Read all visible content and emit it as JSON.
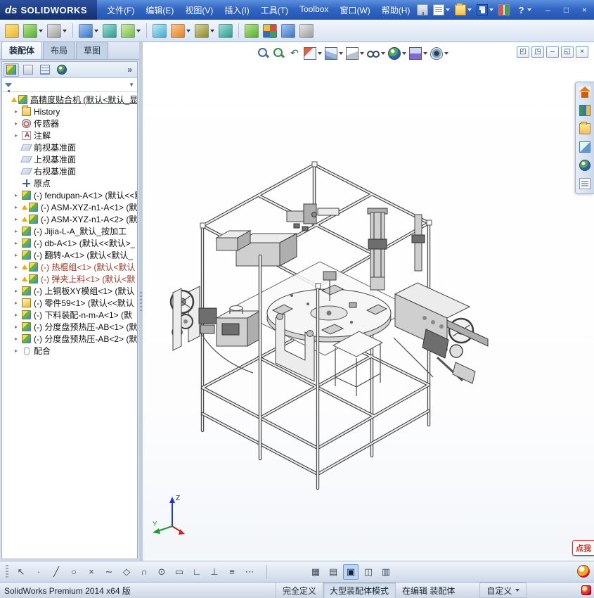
{
  "titlebar": {
    "logo_mark": "ds",
    "logo_brand": "SOLIDWORKS",
    "menus": [
      {
        "label": "文件(F)",
        "name": "menu-file"
      },
      {
        "label": "编辑(E)",
        "name": "menu-edit"
      },
      {
        "label": "视图(V)",
        "name": "menu-view"
      },
      {
        "label": "插入(I)",
        "name": "menu-insert"
      },
      {
        "label": "工具(T)",
        "name": "menu-tools"
      },
      {
        "label": "Toolbox",
        "name": "menu-toolbox"
      },
      {
        "label": "窗口(W)",
        "name": "menu-window"
      },
      {
        "label": "帮助(H)",
        "name": "menu-help"
      }
    ],
    "quick_icons": [
      {
        "name": "pin-icon",
        "cls": "i-pin"
      },
      {
        "name": "new-document-icon",
        "cls": "i-new",
        "dd": true
      },
      {
        "name": "open-icon",
        "cls": "i-folder",
        "dd": true
      },
      {
        "name": "save-icon",
        "cls": "i-save",
        "dd": true
      },
      {
        "name": "selection-filter-icon",
        "cls": "i-options"
      },
      {
        "name": "help-icon",
        "cls": "i-help",
        "dd": true
      }
    ],
    "window_buttons": [
      {
        "name": "minimize-window-button",
        "glyph": "–"
      },
      {
        "name": "restore-window-button",
        "glyph": "□"
      },
      {
        "name": "close-window-button",
        "glyph": "×"
      }
    ]
  },
  "toolbar": {
    "icons": [
      {
        "name": "edit-component-icon",
        "cls": "tn-yellow"
      },
      {
        "name": "insert-components-icon",
        "cls": "tn-green",
        "dd": true
      },
      {
        "name": "mate-icon",
        "cls": "tn-gray",
        "dd": true
      },
      {
        "sep": true
      },
      {
        "name": "component-pattern-icon",
        "cls": "tn-blue",
        "dd": true
      },
      {
        "name": "smart-fasteners-icon",
        "cls": "tn-teal"
      },
      {
        "name": "move-component-icon",
        "cls": "tn-green2",
        "dd": true
      },
      {
        "sep": true
      },
      {
        "name": "show-hidden-components-icon",
        "cls": "tn-cyan"
      },
      {
        "name": "assembly-features-icon",
        "cls": "tn-orange",
        "dd": true
      },
      {
        "name": "reference-geometry-icon",
        "cls": "tn-olive",
        "dd": true
      },
      {
        "name": "new-motion-study-icon",
        "cls": "tn-teal"
      },
      {
        "sep": true
      },
      {
        "name": "bill-of-materials-icon",
        "cls": "tn-green"
      },
      {
        "name": "exploded-view-icon",
        "cls": "tn-multi"
      },
      {
        "name": "instant3d-icon",
        "cls": "tn-blue"
      },
      {
        "name": "large-assembly-mode-icon",
        "cls": "tn-gray"
      }
    ]
  },
  "tabs": [
    {
      "label": "装配体",
      "name": "tab-assembly",
      "active": true
    },
    {
      "label": "布局",
      "name": "tab-layout"
    },
    {
      "label": "草图",
      "name": "tab-sketch"
    }
  ],
  "panel": {
    "tab_icons": [
      {
        "name": "featuremanager-tab-icon",
        "cls": "pt-asm",
        "active": true
      },
      {
        "name": "propertymanager-tab-icon",
        "cls": "pt-prop"
      },
      {
        "name": "configurationmanager-tab-icon",
        "cls": "pt-config"
      },
      {
        "name": "displaymanager-tab-icon",
        "cls": "i-ball"
      }
    ],
    "overflow": "»",
    "filter": {
      "dd": "▼"
    }
  },
  "tree": {
    "items": [
      {
        "label": "高精度贴合机 (默认<默认_显",
        "icon": "assembly-icon",
        "cls": "ic-asm",
        "root": true,
        "warn": true,
        "underline": true
      },
      {
        "label": "History",
        "icon": "history-folder-icon",
        "cls": "ic-hist",
        "expand": true
      },
      {
        "label": "传感器",
        "icon": "sensors-icon",
        "cls": "ic-sensor",
        "expand": true
      },
      {
        "label": "注解",
        "icon": "annotations-icon",
        "cls": "ic-ann",
        "expand": true
      },
      {
        "label": "前视基准面",
        "icon": "front-plane-icon",
        "cls": "ic-plane"
      },
      {
        "label": "上视基准面",
        "icon": "top-plane-icon",
        "cls": "ic-plane"
      },
      {
        "label": "右视基准面",
        "icon": "right-plane-icon",
        "cls": "ic-plane"
      },
      {
        "label": "原点",
        "icon": "origin-icon",
        "cls": "ic-origin"
      },
      {
        "label": "(-) fendupan-A<1> (默认<<默",
        "icon": "subassembly-icon",
        "cls": "ic-asm",
        "expand": true
      },
      {
        "label": "(-) ASM-XYZ-n1-A<1> (默",
        "icon": "subassembly-icon",
        "cls": "ic-asm",
        "warn": true,
        "expand": true
      },
      {
        "label": "(-) ASM-XYZ-n1-A<2> (默",
        "icon": "subassembly-icon",
        "cls": "ic-asm",
        "warn": true,
        "expand": true
      },
      {
        "label": "(-) Jijia-L-A_默认_按加工",
        "icon": "subassembly-icon",
        "cls": "ic-asm",
        "expand": true
      },
      {
        "label": "(-) db-A<1> (默认<<默认>_",
        "icon": "subassembly-icon",
        "cls": "ic-asm",
        "expand": true
      },
      {
        "label": "(-) 翻转-A<1> (默认<默认_",
        "icon": "subassembly-icon",
        "cls": "ic-asm",
        "expand": true
      },
      {
        "label": "(-) 热棍组<1> (默认<默认",
        "icon": "subassembly-icon",
        "cls": "ic-asm",
        "warn": true,
        "expand": true,
        "red": true
      },
      {
        "label": "(-) 弹夹上料<1> (默认<默",
        "icon": "subassembly-icon",
        "cls": "ic-asm",
        "warn": true,
        "expand": true,
        "red": true
      },
      {
        "label": "(-) 上铜板XY模组<1> (默认",
        "icon": "subassembly-icon",
        "cls": "ic-asm",
        "expand": true
      },
      {
        "label": "(-) 零件59<1> (默认<<默认",
        "icon": "part-icon",
        "cls": "ic-part",
        "expand": true
      },
      {
        "label": "(-) 下料装配-n-m-A<1> (默",
        "icon": "subassembly-icon",
        "cls": "ic-asm",
        "expand": true
      },
      {
        "label": "(-) 分度盘预热压-AB<1> (默",
        "icon": "subassembly-icon",
        "cls": "ic-asm",
        "expand": true
      },
      {
        "label": "(-) 分度盘预热压-AB<2> (默",
        "icon": "subassembly-icon",
        "cls": "ic-asm",
        "expand": true
      },
      {
        "label": "配合",
        "icon": "mates-icon",
        "cls": "ic-mate",
        "expand": true
      }
    ]
  },
  "viewbar": {
    "icons": [
      {
        "name": "zoom-fit-icon",
        "cls": "vb-zoomfit"
      },
      {
        "name": "zoom-area-icon",
        "cls": "vb-zoomarea"
      },
      {
        "name": "previous-view-icon",
        "cls": "vb-prev"
      },
      {
        "name": "section-view-icon",
        "cls": "vb-section",
        "dd": true
      },
      {
        "name": "view-orientation-icon",
        "cls": "vb-cube",
        "dd": true
      },
      {
        "name": "display-style-icon",
        "cls": "vb-display",
        "dd": true
      },
      {
        "name": "hide-show-items-icon",
        "cls": "vb-glasses",
        "dd": true
      },
      {
        "name": "edit-appearance-icon",
        "cls": "i-ball",
        "dd": true
      },
      {
        "name": "apply-scene-icon",
        "cls": "vb-scene",
        "dd": true
      },
      {
        "name": "view-settings-icon",
        "cls": "vb-eye",
        "dd": true
      }
    ]
  },
  "mdi_buttons": [
    {
      "name": "cascade-doc-icon",
      "glyph": "◰"
    },
    {
      "name": "tile-doc-icon",
      "glyph": "◳"
    },
    {
      "name": "minimize-doc-icon",
      "glyph": "–"
    },
    {
      "name": "restore-doc-icon",
      "glyph": "◱"
    },
    {
      "name": "close-doc-icon",
      "glyph": "×"
    }
  ],
  "taskpane": {
    "icons": [
      {
        "name": "solidworks-resources-icon",
        "cls": "i-house"
      },
      {
        "name": "design-library-icon",
        "cls": "i-library"
      },
      {
        "name": "file-explorer-icon",
        "cls": "i-folder"
      },
      {
        "name": "view-palette-icon",
        "cls": "i-palette"
      },
      {
        "name": "appearances-scenes-icon",
        "cls": "i-ball"
      },
      {
        "name": "custom-properties-icon",
        "cls": "i-doc"
      }
    ]
  },
  "triad": {
    "z": "Z",
    "y": "Y"
  },
  "badge": {
    "label": "点我"
  },
  "sketchbar": {
    "icons": [
      {
        "name": "select-icon",
        "glyph": "↖"
      },
      {
        "name": "sketch-point-icon",
        "glyph": "∙"
      },
      {
        "name": "sketch-line-icon",
        "glyph": "╱"
      },
      {
        "name": "sketch-circle-icon",
        "glyph": "○"
      },
      {
        "name": "sketch-erase-icon",
        "glyph": "×"
      },
      {
        "name": "sketch-spline-icon",
        "glyph": "∼"
      },
      {
        "name": "sketch-polygon-icon",
        "glyph": "◇"
      },
      {
        "name": "sketch-arc-icon",
        "glyph": "∩"
      },
      {
        "name": "sketch-ellipse-icon",
        "glyph": "⊙"
      },
      {
        "name": "sketch-rectangle-icon",
        "glyph": "▭"
      },
      {
        "name": "sketch-corner-icon",
        "glyph": "∟"
      },
      {
        "name": "sketch-trim-icon",
        "glyph": "⊥"
      },
      {
        "name": "sketch-relations-icon",
        "glyph": "≡"
      },
      {
        "name": "sketch-dimension-icon",
        "glyph": "⋯"
      },
      {
        "sep": true
      },
      {
        "name": "sketch-pattern-icon",
        "glyph": "▦"
      },
      {
        "name": "grid-settings-icon",
        "glyph": "▤"
      },
      {
        "name": "shaded-contours-icon",
        "glyph": "▣",
        "active": true
      },
      {
        "name": "section-display-icon",
        "glyph": "◫"
      },
      {
        "name": "table-icon",
        "glyph": "▥"
      }
    ]
  },
  "statusbar": {
    "left": "SolidWorks Premium 2014 x64 版",
    "cells": [
      {
        "label": "完全定义",
        "name": "status-fully-defined"
      },
      {
        "label": "大型装配体模式",
        "name": "status-large-assembly-mode",
        "pressed": true
      },
      {
        "label": "在编辑 装配体",
        "name": "status-editing-assembly"
      },
      {
        "label": "自定义",
        "name": "status-customize",
        "dd": true
      }
    ]
  }
}
